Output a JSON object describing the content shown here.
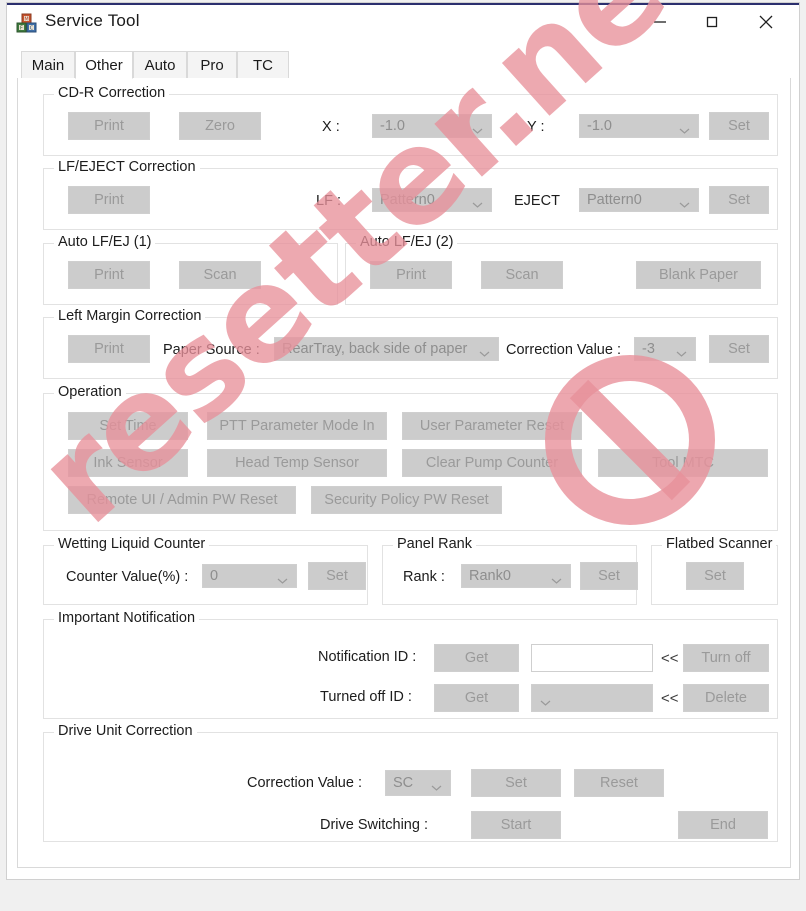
{
  "window": {
    "title": "Service Tool",
    "icon": "blocks-icon",
    "controls": {
      "minimize": "minimize-icon",
      "maximize": "maximize-icon",
      "close": "close-icon"
    }
  },
  "tabs": [
    {
      "label": "Main",
      "active": false
    },
    {
      "label": "Other",
      "active": true
    },
    {
      "label": "Auto",
      "active": false
    },
    {
      "label": "Pro",
      "active": false
    },
    {
      "label": "TC",
      "active": false
    }
  ],
  "groups": {
    "cdr": {
      "title": "CD-R Correction",
      "print": "Print",
      "zero": "Zero",
      "x_label": "X :",
      "x_value": "-1.0",
      "y_label": "Y :",
      "y_value": "-1.0",
      "set": "Set"
    },
    "lf_eject": {
      "title": "LF/EJECT Correction",
      "print": "Print",
      "lf_label": "LF :",
      "lf_value": "Pattern0",
      "eject_label": "EJECT",
      "eject_value": "Pattern0",
      "set": "Set"
    },
    "auto_lfej1": {
      "title": "Auto LF/EJ (1)",
      "print": "Print",
      "scan": "Scan"
    },
    "auto_lfej2": {
      "title": "Auto LF/EJ (2)",
      "print": "Print",
      "scan": "Scan",
      "blank_paper": "Blank Paper"
    },
    "left_margin": {
      "title": "Left Margin Correction",
      "print": "Print",
      "paper_source_label": "Paper Source :",
      "paper_source_value": "RearTray, back side of paper",
      "correction_label": "Correction Value :",
      "correction_value": "-3",
      "set": "Set"
    },
    "operation": {
      "title": "Operation",
      "set_time": "Set Time",
      "ptt_parameter_mode_in": "PTT Parameter Mode In",
      "user_parameter_reset": "User Parameter Reset",
      "ink_sensor": "Ink Sensor",
      "head_temp_sensor": "Head Temp Sensor",
      "clear_pump_counter": "Clear Pump Counter",
      "tool_mtc": "Tool MTC",
      "remote_ui_admin_pw_reset": "Remote UI / Admin PW Reset",
      "security_policy_pw_reset": "Security Policy PW Reset"
    },
    "wetting": {
      "title": "Wetting Liquid Counter",
      "counter_label": "Counter Value(%) :",
      "counter_value": "0",
      "set": "Set"
    },
    "panel_rank": {
      "title": "Panel Rank",
      "rank_label": "Rank :",
      "rank_value": "Rank0",
      "set": "Set"
    },
    "flatbed": {
      "title": "Flatbed Scanner",
      "set": "Set"
    },
    "notification": {
      "title": "Important Notification",
      "notification_id_label": "Notification ID :",
      "notification_id_get": "Get",
      "notification_id_value": "",
      "notification_id_placeholder": "",
      "chevrons": "<<",
      "turn_off": "Turn off",
      "turned_off_id_label": "Turned off ID :",
      "turned_off_id_get": "Get",
      "turned_off_id_value": "",
      "delete": "Delete"
    },
    "drive_unit": {
      "title": "Drive Unit Correction",
      "correction_label": "Correction Value :",
      "correction_value": "SC",
      "set": "Set",
      "reset": "Reset",
      "drive_switching_label": "Drive Switching :",
      "start": "Start",
      "end": "End"
    }
  },
  "watermark": {
    "text": "resetter.net",
    "color": "#e8919b"
  }
}
